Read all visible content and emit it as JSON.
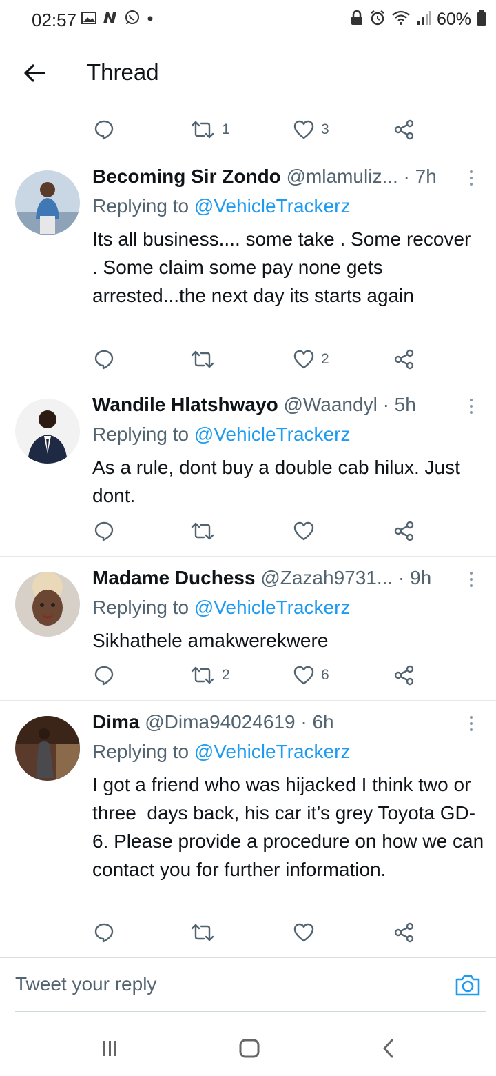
{
  "status_bar": {
    "time": "02:57",
    "battery": "60%",
    "left_icons": [
      "gallery-icon",
      "n-app-icon",
      "whatsapp-icon",
      "dot-icon"
    ],
    "right_icons": [
      "lock-icon",
      "alarm-icon",
      "wifi-icon",
      "signal-icon",
      "battery-icon"
    ]
  },
  "header": {
    "title": "Thread",
    "back_icon": "arrow-left-icon"
  },
  "top_actions": {
    "retweets": "1",
    "likes": "3"
  },
  "tweets": [
    {
      "name": "Becoming Sir Zondo",
      "handle": "@mlamuliz...",
      "time": " · 7h",
      "replying_prefix": "Replying to ",
      "replying_to": "@VehicleTrackerz",
      "text": "Its all business.... some take . Some recover  . Some claim some pay none gets arrested...the next day its starts again",
      "retweets": "",
      "likes": "2"
    },
    {
      "name": "Wandile Hlatshwayo",
      "handle": "@Waandyl",
      "time": " · 5h",
      "replying_prefix": "Replying to ",
      "replying_to": "@VehicleTrackerz",
      "text": "As a rule, dont buy a double cab hilux. Just dont.",
      "retweets": "",
      "likes": ""
    },
    {
      "name": "Madame Duchess",
      "handle": "@Zazah9731...",
      "time": " · 9h",
      "replying_prefix": "Replying to ",
      "replying_to": "@VehicleTrackerz",
      "text": "Sikhathele amakwerekwere",
      "retweets": "2",
      "likes": "6"
    },
    {
      "name": "Dima",
      "handle": "@Dima94024619",
      "time": " · 6h",
      "replying_prefix": "Replying to ",
      "replying_to": "@VehicleTrackerz",
      "text": "I got a friend who was hijacked I think two or  three  days back, his car it’s grey Toyota GD-6. Please provide a procedure on how we can contact you for further information.",
      "retweets": "",
      "likes": ""
    }
  ],
  "reply": {
    "placeholder": "Tweet your reply",
    "camera_icon": "camera-icon"
  },
  "nav": {
    "icons": [
      "recents-icon",
      "home-icon",
      "back-icon"
    ]
  },
  "colors": {
    "accent": "#1d9bf0",
    "text": "#0f1419",
    "muted": "#536471",
    "divider": "#e6e9ec"
  }
}
